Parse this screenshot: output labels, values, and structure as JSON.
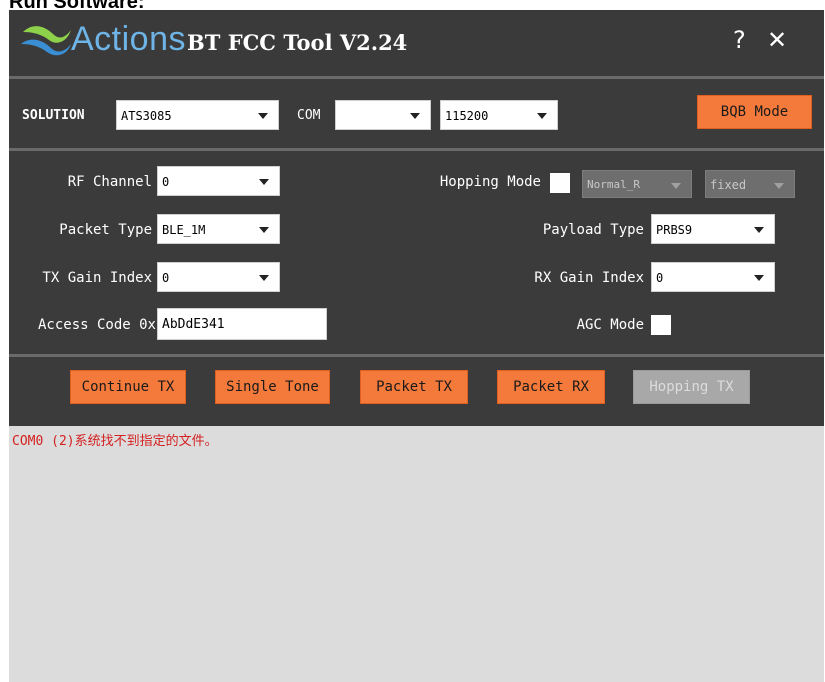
{
  "heading": "Run Software:",
  "window": {
    "brand": "Actions",
    "title": "BT FCC Tool V2.24",
    "help_label": "?",
    "close_label": "✕"
  },
  "toolbar": {
    "solution_label": "SOLUTION",
    "solution_value": "ATS3085",
    "com_label": "COM",
    "com_value": "",
    "baud_value": "115200",
    "bqb_label": "BQB Mode"
  },
  "settings": {
    "rf_channel_label": "RF Channel",
    "rf_channel_value": "0",
    "hopping_mode_label": "Hopping Mode",
    "hopping_mode_value": "Normal_R",
    "hopping_fixed_value": "fixed",
    "packet_type_label": "Packet Type",
    "packet_type_value": "BLE_1M",
    "payload_type_label": "Payload Type",
    "payload_type_value": "PRBS9",
    "tx_gain_label": "TX Gain Index",
    "tx_gain_value": "0",
    "rx_gain_label": "RX Gain Index",
    "rx_gain_value": "0",
    "access_code_label": "Access Code 0x",
    "access_code_value": "AbDdE341",
    "agc_mode_label": "AGC Mode"
  },
  "actions": {
    "continue_tx": "Continue TX",
    "single_tone": "Single Tone",
    "packet_tx": "Packet TX",
    "packet_rx": "Packet RX",
    "hopping_tx": "Hopping TX"
  },
  "log": {
    "lines": [
      "COM0 (2)系统找不到指定的文件。"
    ]
  },
  "colors": {
    "accent_orange": "#f47a3c",
    "window_bg": "#3b3b3b",
    "log_error": "#d42020"
  }
}
